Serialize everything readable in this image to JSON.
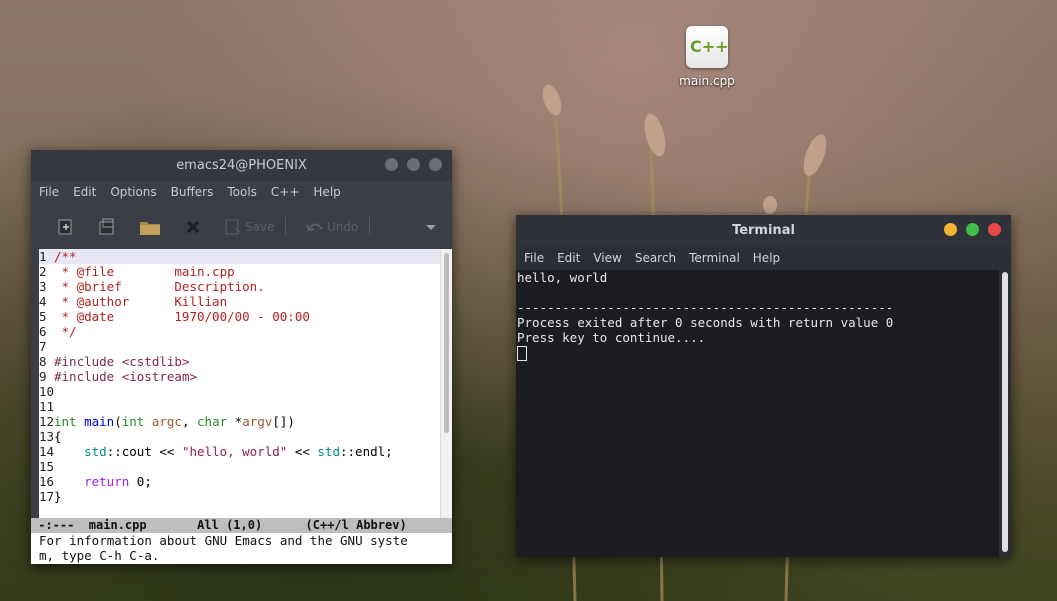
{
  "desktop": {
    "icon": {
      "glyph": "C++",
      "label": "main.cpp",
      "icon_name": "cpp-file-icon"
    }
  },
  "emacs": {
    "title": "emacs24@PHOENIX",
    "menu": [
      "File",
      "Edit",
      "Options",
      "Buffers",
      "Tools",
      "C++",
      "Help"
    ],
    "toolbar": {
      "save": "Save",
      "undo": "Undo"
    },
    "lines": [
      {
        "n": "1",
        "segs": [
          {
            "t": "/**",
            "c": "c-com"
          }
        ]
      },
      {
        "n": "2",
        "segs": [
          {
            "t": " * @file        main.cpp",
            "c": "c-com"
          }
        ]
      },
      {
        "n": "3",
        "segs": [
          {
            "t": " * @brief       Description.",
            "c": "c-com"
          }
        ]
      },
      {
        "n": "4",
        "segs": [
          {
            "t": " * @author      Killian",
            "c": "c-com"
          }
        ]
      },
      {
        "n": "5",
        "segs": [
          {
            "t": " * @date        1970/00/00 - 00:00",
            "c": "c-com"
          }
        ]
      },
      {
        "n": "6",
        "segs": [
          {
            "t": " */",
            "c": "c-com"
          }
        ]
      },
      {
        "n": "7",
        "segs": []
      },
      {
        "n": "8",
        "segs": [
          {
            "t": "#include ",
            "c": "c-pre"
          },
          {
            "t": "<cstdlib>",
            "c": "c-str"
          }
        ]
      },
      {
        "n": "9",
        "segs": [
          {
            "t": "#include ",
            "c": "c-pre"
          },
          {
            "t": "<iostream>",
            "c": "c-str"
          }
        ]
      },
      {
        "n": "10",
        "segs": []
      },
      {
        "n": "11",
        "segs": []
      },
      {
        "n": "12",
        "segs": [
          {
            "t": "int",
            "c": "c-typ"
          },
          {
            "t": " "
          },
          {
            "t": "main",
            "c": "c-fn"
          },
          {
            "t": "("
          },
          {
            "t": "int",
            "c": "c-typ"
          },
          {
            "t": " "
          },
          {
            "t": "argc",
            "c": "c-var"
          },
          {
            "t": ", "
          },
          {
            "t": "char",
            "c": "c-typ"
          },
          {
            "t": " *"
          },
          {
            "t": "argv",
            "c": "c-var"
          },
          {
            "t": "[])"
          }
        ]
      },
      {
        "n": "13",
        "segs": [
          {
            "t": "{"
          }
        ]
      },
      {
        "n": "14",
        "segs": [
          {
            "t": "    "
          },
          {
            "t": "std",
            "c": "c-cst"
          },
          {
            "t": "::cout << "
          },
          {
            "t": "\"hello, world\"",
            "c": "c-str"
          },
          {
            "t": " << "
          },
          {
            "t": "std",
            "c": "c-cst"
          },
          {
            "t": "::endl;"
          }
        ]
      },
      {
        "n": "15",
        "segs": []
      },
      {
        "n": "16",
        "segs": [
          {
            "t": "    "
          },
          {
            "t": "return",
            "c": "c-kw"
          },
          {
            "t": " 0;"
          }
        ]
      },
      {
        "n": "17",
        "segs": [
          {
            "t": "}"
          }
        ]
      }
    ],
    "modeline": " -:---  main.cpp       All (1,0)      (C++/l Abbrev)",
    "echo": [
      "For information about GNU Emacs and the GNU syste",
      "m, type C-h C-a."
    ]
  },
  "terminal": {
    "title": "Terminal",
    "menu": [
      "File",
      "Edit",
      "View",
      "Search",
      "Terminal",
      "Help"
    ],
    "output": [
      "hello, world",
      "",
      "--------------------------------------------------",
      "Process exited after 0 seconds with return value 0",
      "Press key to continue...."
    ],
    "colors": {
      "close": "#e94b4b",
      "maximize": "#3fbf4a",
      "minimize": "#f2b233"
    }
  }
}
